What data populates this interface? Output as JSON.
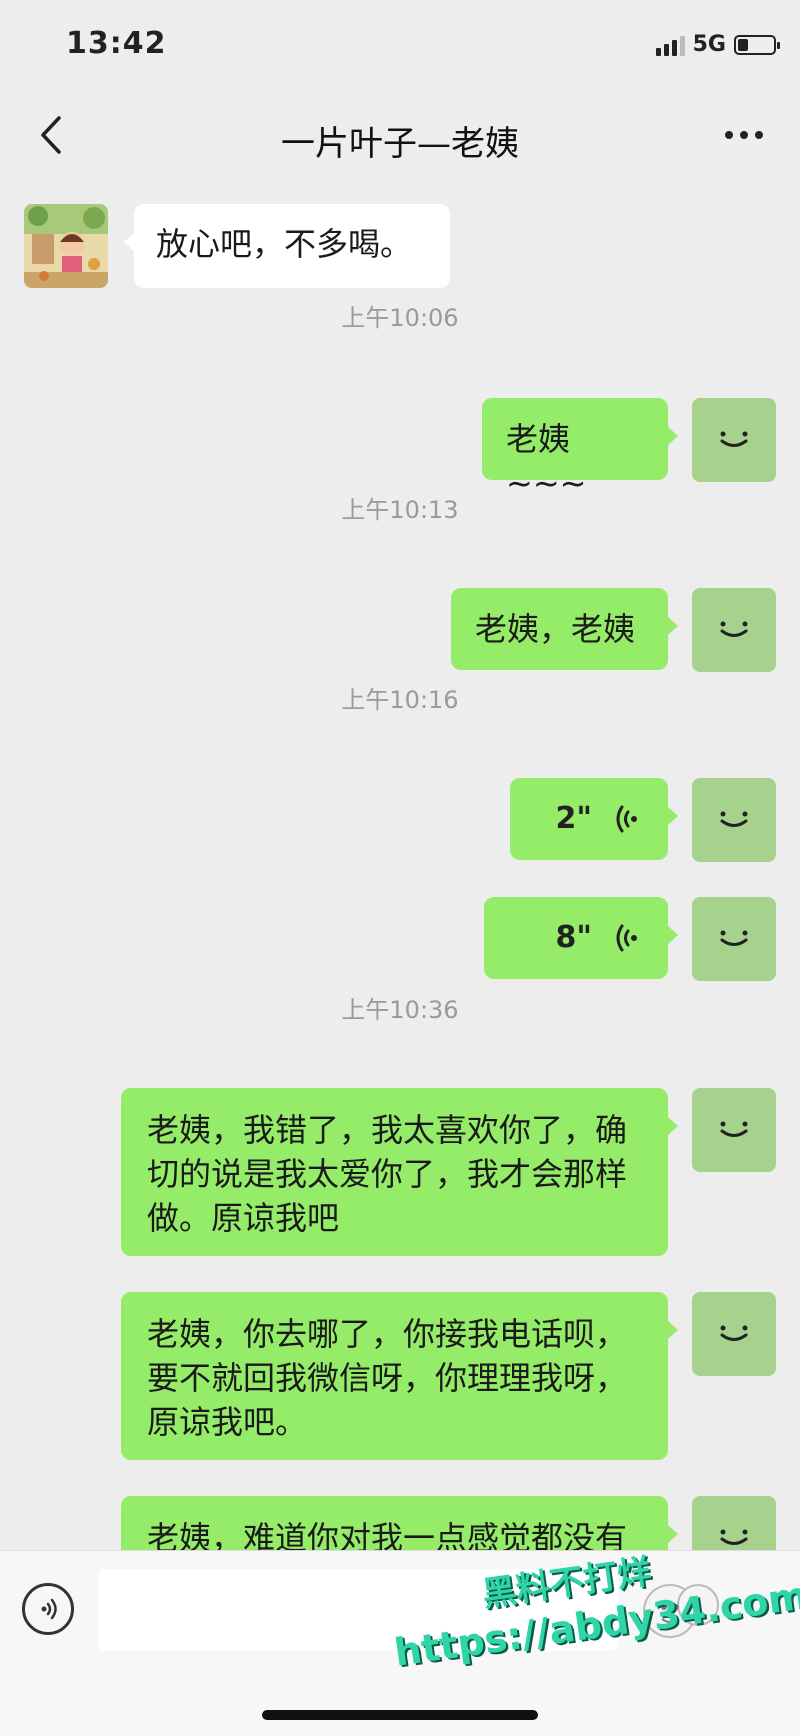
{
  "status_bar": {
    "time": "13:42",
    "network": "5G"
  },
  "nav": {
    "title": "一片叶子—老姨"
  },
  "messages": {
    "m1": "放心吧，不多喝。",
    "ts1": "上午10:06",
    "m2": "老姨~~~",
    "ts2": "上午10:13",
    "m3": "老姨，老姨",
    "ts3": "上午10:16",
    "voice1": "2\"",
    "voice2": "8\"",
    "ts4": "上午10:36",
    "m4": "老姨，我错了，我太喜欢你了，确\n切的说是我太爱你了，我才会那样\n做。原谅我吧",
    "m5": "老姨，你去哪了，你接我电话呗，\n要不就回我微信呀，你理理我呀，\n原谅我吧。",
    "m6": "老姨，难道你对我一点感觉都没有"
  },
  "input": {
    "value": "",
    "placeholder": ""
  },
  "watermark": {
    "line1": "黑料不打烊",
    "line2": "https://abdy34.com"
  },
  "colors": {
    "background": "#ededed",
    "bubble_out": "#95ec69",
    "bubble_in": "#ffffff",
    "self_avatar": "#a6d28d"
  },
  "icons": {
    "back": "chevron-left-icon",
    "more": "more-dots-icon",
    "self_avatar": "smiley-icon",
    "voice_wave": "voice-wave-icon",
    "voice_toggle": "voice-input-icon"
  }
}
